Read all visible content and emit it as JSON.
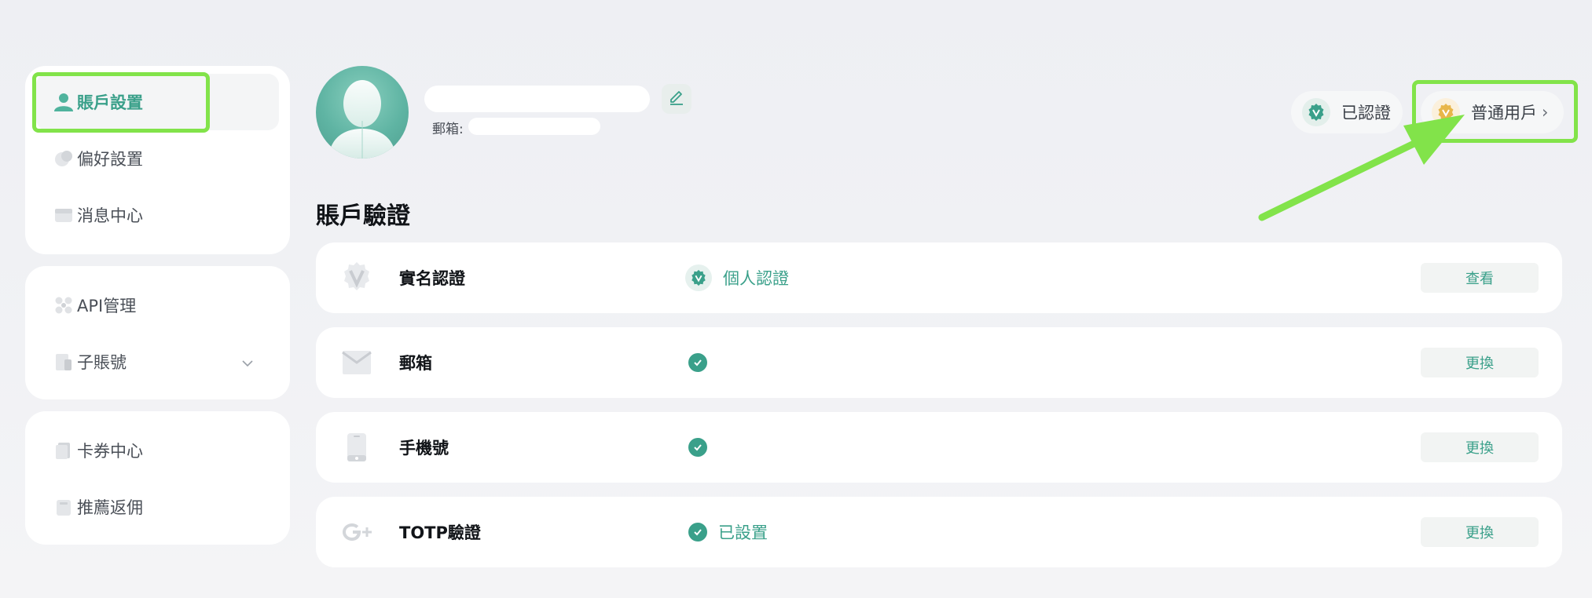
{
  "sidebar": {
    "group1": [
      {
        "label": "賬戶設置",
        "icon": "user-icon",
        "active": true
      },
      {
        "label": "偏好設置",
        "icon": "preferences-icon"
      },
      {
        "label": "消息中心",
        "icon": "message-icon"
      }
    ],
    "group2": [
      {
        "label": "API管理",
        "icon": "api-icon"
      },
      {
        "label": "子賬號",
        "icon": "sub-account-icon",
        "expandable": true
      }
    ],
    "group3": [
      {
        "label": "卡券中心",
        "icon": "coupon-icon"
      },
      {
        "label": "推薦返佣",
        "icon": "referral-icon"
      }
    ]
  },
  "profile": {
    "email_label": "郵箱:"
  },
  "header_pills": {
    "verified_label": "已認證",
    "user_level_label": "普通用戶",
    "user_level_chevron": "›"
  },
  "section": {
    "title": "賬戶驗證"
  },
  "verifications": [
    {
      "label": "實名認證",
      "icon": "identity-icon",
      "status_text": "個人認證",
      "status_type": "badge",
      "action": "查看"
    },
    {
      "label": "郵箱",
      "icon": "mail-icon",
      "status_text": "",
      "status_type": "check",
      "action": "更換"
    },
    {
      "label": "手機號",
      "icon": "phone-icon",
      "status_text": "",
      "status_type": "check",
      "action": "更換"
    },
    {
      "label": "TOTP驗證",
      "icon": "google-auth-icon",
      "status_text": "已設置",
      "status_type": "check",
      "action": "更換"
    }
  ],
  "colors": {
    "accent": "#3aa08a",
    "highlight": "#82e34a",
    "gold": "#e8b64a"
  }
}
